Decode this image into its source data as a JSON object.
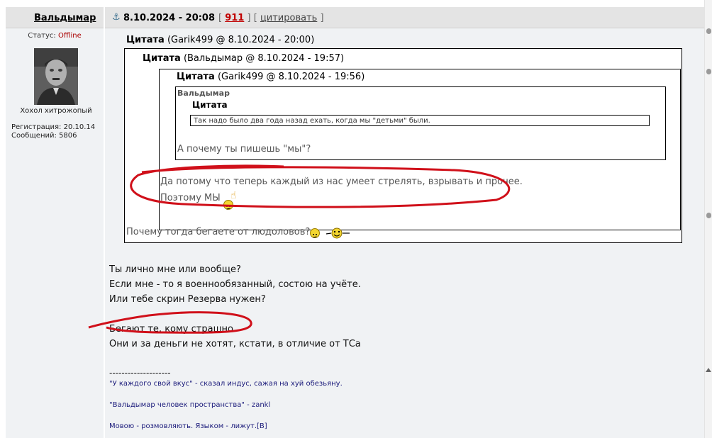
{
  "user": {
    "name": "Вальдымар",
    "status_label": "Статус:",
    "status_value": "Offline",
    "rank": "Хохол хитрожопый",
    "reg_label": "Регистрация:",
    "reg_date": "20.10.14",
    "posts_label": "Сообщений:",
    "posts_count": "5806"
  },
  "post": {
    "date": "8.10.2024 - 20:08",
    "number": "911",
    "quote_button": "цитировать",
    "bracket_open": "[",
    "bracket_close": "]"
  },
  "quote_outer": {
    "label": "Цитата",
    "meta": "(Garik499 @ 8.10.2024 - 20:00)",
    "reply": "Почему тогда бегаете от людоловов?"
  },
  "quote_mid": {
    "label": "Цитата",
    "meta": "(Вальдымар @ 8.10.2024 - 19:57)"
  },
  "quote_inner": {
    "label": "Цитата",
    "meta": "(Garik499 @ 8.10.2024 - 19:56)",
    "line1": "Да потому что теперь каждый из нас умеет стрелять, взрывать и прочее.",
    "line2": "Поэтому МЫ"
  },
  "quote_deep": {
    "author": "Вальдымар",
    "label": "Цитата",
    "text": "Так надо было два года назад ехать, когда мы \"детьми\" были.",
    "reply": "А почему ты пишешь \"мы\"?"
  },
  "message": {
    "lines": [
      "Ты лично мне или вообще?",
      "Если мне - то я военнообязанный, состою на учёте.",
      "Или тебе скрин Резерва нужен?",
      "",
      "Бегают те, кому страшно.",
      "Они и за деньги не хотят, кстати, в отличие от ТСа"
    ]
  },
  "signature": {
    "divider": "--------------------",
    "lines": [
      "\"У каждого свой вкус\" - сказал индус, сажая на хуй обезьяну.",
      "\"Вальдымар человек пространства\" - zankl",
      "Мовою - розмовляють. Языком - лижут.[B]"
    ]
  },
  "colors": {
    "header_bg": "#e4e4e4",
    "panel_bg": "#f0f2f4",
    "offline": "#aa0000",
    "post_number": "#c00000",
    "annotation": "#d0101a"
  },
  "icons": [
    "anchor-icon",
    "hmm-smiley-icon",
    "pointing-hand-icon",
    "dancing-smiley-icon"
  ]
}
